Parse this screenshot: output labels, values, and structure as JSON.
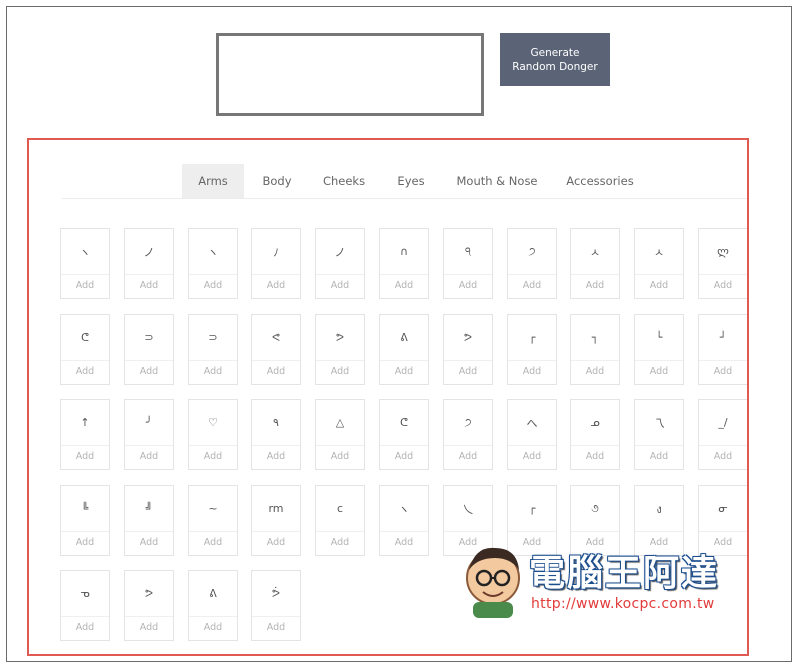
{
  "generate_button": {
    "label": "Generate\nRandom Donger"
  },
  "tabs": [
    {
      "label": "Arms",
      "active": true
    },
    {
      "label": "Body",
      "active": false
    },
    {
      "label": "Cheeks",
      "active": false
    },
    {
      "label": "Eyes",
      "active": false
    },
    {
      "label": "Mouth & Nose",
      "active": false
    },
    {
      "label": "Accessories",
      "active": false
    }
  ],
  "add_label": "Add",
  "arms": [
    "ヽ",
    "ノ",
    "ヽ",
    "ﾉ",
    "ノ",
    "∩",
    "੧",
    "੭",
    "ㅅ",
    "ㅅ",
    "ლ",
    "ᕦ",
    "⊃",
    "⊃",
    "ᕙ",
    "ᕗ",
    "ᕕ",
    "ᕗ",
    "┌",
    "┐",
    "└",
    "┘",
    "↑",
    "╯",
    "♡",
    "٩",
    "△",
    "ᕦ",
    "੭",
    "へ",
    "ᓄ",
    "乁",
    "_/",
    "╚",
    "╝",
    "~",
    "rm",
    "c",
    "ヽ",
    "乀",
    "┌",
    "૭",
    "ง",
    "ᓂ",
    "ᓀ",
    "ᕗ",
    "ᕕ",
    "ᕘ"
  ],
  "watermark": {
    "title": "電腦王阿達",
    "url": "http://www.kocpc.com.tw",
    "accent": "#e23b3b"
  }
}
